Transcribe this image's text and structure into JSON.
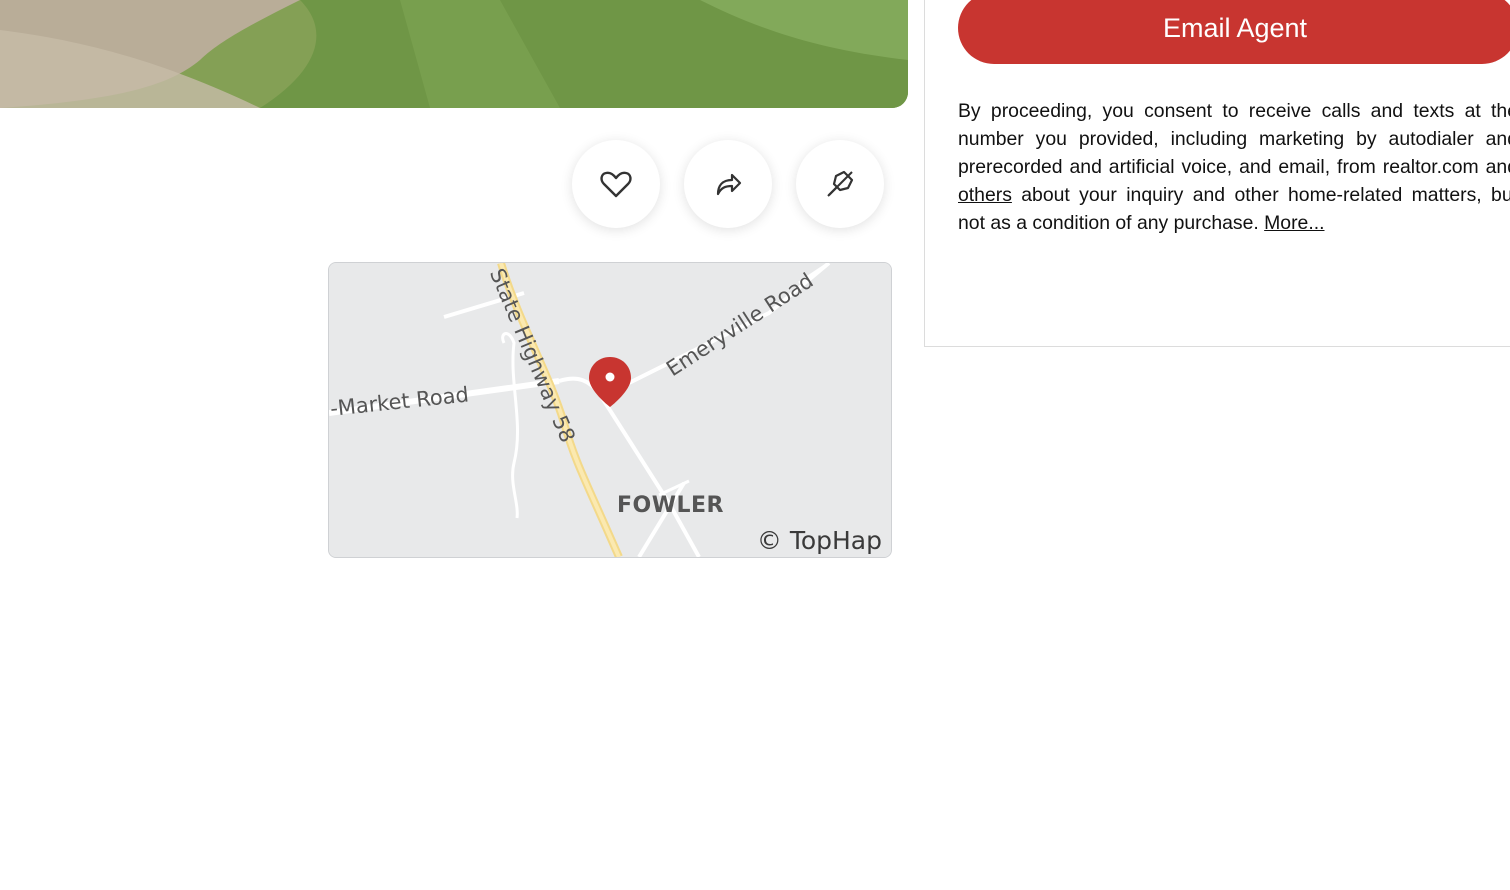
{
  "photo": {
    "alt": "property photo"
  },
  "actions": {
    "favorite": {
      "icon": "heart-icon"
    },
    "share": {
      "icon": "share-arrow-icon"
    },
    "hide": {
      "icon": "hide-pin-icon"
    }
  },
  "map": {
    "roads": [
      "State Highway 58",
      "Emeryville Road",
      "-Market Road"
    ],
    "town": "FOWLER",
    "credit": "© TopHap",
    "marker_icon": "map-pin-icon",
    "marker_color": "#c83530"
  },
  "agent": {
    "email_button": "Email Agent",
    "button_color": "#c83530"
  },
  "consent": {
    "text_1": "By proceeding, you consent to receive calls and texts at the number you provided, including marketing by autodialer and prerecorded and artificial voice, and email, from realtor.com and ",
    "others_link": "others",
    "text_2": " about your inquiry and other home-related matters, but not as a condition of any purchase. ",
    "more_link": "More..."
  }
}
